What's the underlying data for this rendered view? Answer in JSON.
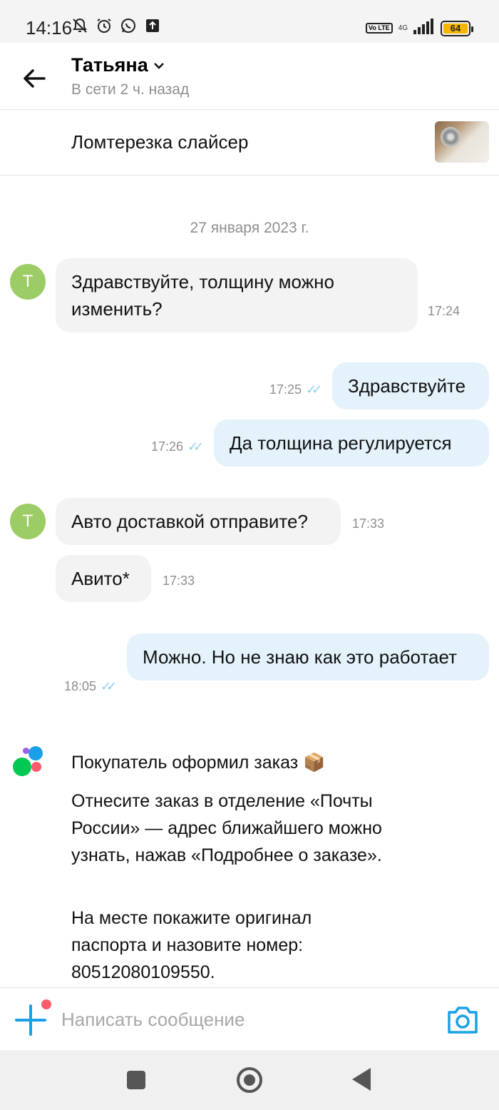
{
  "status_bar": {
    "time": "14:16",
    "network": "4G",
    "volte": "Vo LTE",
    "battery": "64"
  },
  "header": {
    "contact_name": "Татьяна",
    "contact_status": "В сети 2 ч. назад"
  },
  "item": {
    "title": "Ломтерезка слайсер"
  },
  "chat": {
    "date": "27 января 2023 г.",
    "avatar_letter": "Т",
    "messages": [
      {
        "direction": "in",
        "text": "Здравствуйте, толщину можно изменить?",
        "time": "17:24"
      },
      {
        "direction": "out",
        "text": "Здравствуйте",
        "time": "17:25"
      },
      {
        "direction": "out",
        "text": "Да толщина регулируется",
        "time": "17:26"
      },
      {
        "direction": "in",
        "text": "Авто доставкой отправите?",
        "time": "17:33"
      },
      {
        "direction": "in",
        "text": "Авито*",
        "time": "17:33"
      },
      {
        "direction": "out",
        "text": "Можно. Но не знаю как это работает",
        "time": "18:05"
      }
    ],
    "system": {
      "title": "Покупатель оформил заказ 📦",
      "paragraph1": "Отнесите заказ в отделение «Почты России» — адрес ближайшего можно узнать, нажав «Подробнее о заказе».",
      "paragraph2": "На месте покажите оригинал паспорта и назовите номер: 80512080109550."
    }
  },
  "input": {
    "placeholder": "Написать сообщение"
  },
  "colors": {
    "accent": "#1aa0e6",
    "incoming_bubble": "#f3f3f3",
    "outgoing_bubble": "#e3f2fb",
    "avatar": "#9ccc65",
    "read_ticks": "#8fd0ef"
  }
}
